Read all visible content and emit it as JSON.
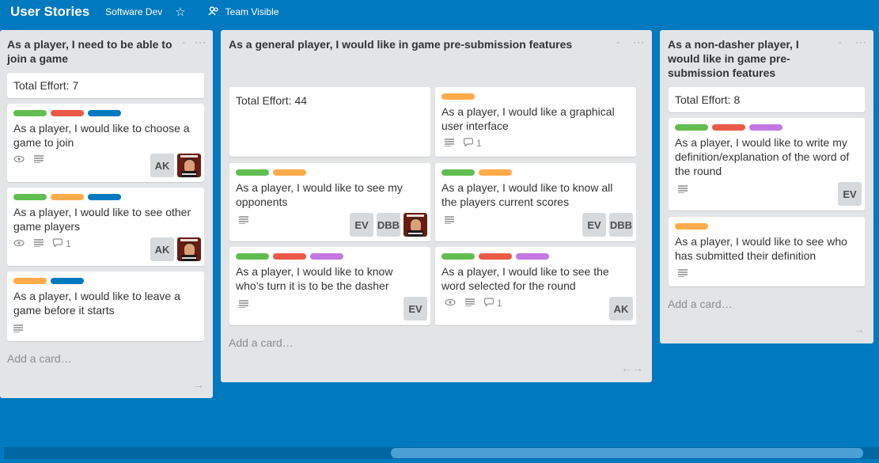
{
  "header": {
    "board_title": "User Stories",
    "team_name": "Software Dev",
    "visibility": "Team Visible",
    "star_icon": "star-icon",
    "team_icon": "team-icon"
  },
  "colors": {
    "board_bg": "#0079bf",
    "green": "#61bd4f",
    "red": "#eb5a46",
    "blue": "#0079bf",
    "orange": "#ffab4a",
    "purple": "#c377e0"
  },
  "lists": [
    {
      "title": "As a player, I need to be able to join a game",
      "menu": "···",
      "add_card": "Add a card…",
      "cards": [
        {
          "text": "Total Effort: 7"
        },
        {
          "text": "As a player, I would like to choose a game to join",
          "members": [
            "AK"
          ]
        },
        {
          "text": "As a player, I would like to see other game players",
          "comments": "1",
          "members": [
            "AK"
          ]
        },
        {
          "text": "As a player, I would like to leave a game before it starts"
        }
      ]
    },
    {
      "title": "As a general player, I would like in game pre-submission features",
      "menu": "···",
      "add_card": "Add a card…",
      "cards": [
        {
          "text": "Total Effort: 44"
        },
        {
          "text": "As a player, I would like a graphical user interface",
          "comments": "1"
        },
        {
          "text": "As a player, I would like to see my opponents",
          "members": [
            "EV",
            "DBB"
          ]
        },
        {
          "text": "As a player, I would like to know all the players current scores",
          "members": [
            "EV",
            "DBB"
          ]
        },
        {
          "text": "As a player, I would like to know who’s turn it is to be the dasher",
          "members": [
            "EV"
          ]
        },
        {
          "text": "As a player, I would like to see the word selected for the round",
          "comments": "1",
          "members": [
            "AK"
          ]
        }
      ]
    },
    {
      "title": "As a non-dasher player, I would like in game pre-submission features",
      "menu": "···",
      "add_card": "Add a card…",
      "cards": [
        {
          "text": "Total Effort: 8"
        },
        {
          "text": "As a player, I would like to write my definition/explanation of the word of the round",
          "members": [
            "EV"
          ]
        },
        {
          "text": "As a player, I would like to see who has submitted their definition"
        }
      ]
    }
  ]
}
